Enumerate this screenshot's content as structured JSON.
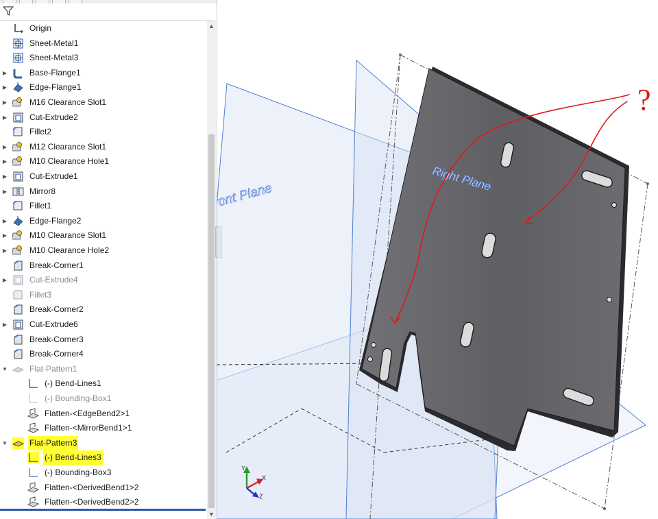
{
  "tree": {
    "items": [
      {
        "label": "Origin",
        "icon": "origin-icon",
        "expand": false,
        "indent": 0,
        "state": "normal"
      },
      {
        "label": "Sheet-Metal1",
        "icon": "sheet-metal-icon",
        "expand": false,
        "indent": 0,
        "state": "normal"
      },
      {
        "label": "Sheet-Metal3",
        "icon": "sheet-metal-icon",
        "expand": false,
        "indent": 0,
        "state": "normal"
      },
      {
        "label": "Base-Flange1",
        "icon": "base-flange-icon",
        "expand": true,
        "indent": 0,
        "state": "normal"
      },
      {
        "label": "Edge-Flange1",
        "icon": "edge-flange-icon",
        "expand": true,
        "indent": 0,
        "state": "normal"
      },
      {
        "label": "M16 Clearance Slot1",
        "icon": "hole-wizard-icon",
        "expand": true,
        "indent": 0,
        "state": "normal"
      },
      {
        "label": "Cut-Extrude2",
        "icon": "cut-extrude-icon",
        "expand": true,
        "indent": 0,
        "state": "normal"
      },
      {
        "label": "Fillet2",
        "icon": "fillet-icon",
        "expand": false,
        "indent": 0,
        "state": "normal"
      },
      {
        "label": "M12 Clearance Slot1",
        "icon": "hole-wizard-icon",
        "expand": true,
        "indent": 0,
        "state": "normal"
      },
      {
        "label": "M10 Clearance Hole1",
        "icon": "hole-wizard-icon",
        "expand": true,
        "indent": 0,
        "state": "normal"
      },
      {
        "label": "Cut-Extrude1",
        "icon": "cut-extrude-icon",
        "expand": true,
        "indent": 0,
        "state": "normal"
      },
      {
        "label": "Mirror8",
        "icon": "mirror-icon",
        "expand": true,
        "indent": 0,
        "state": "normal"
      },
      {
        "label": "Fillet1",
        "icon": "fillet-icon",
        "expand": false,
        "indent": 0,
        "state": "normal"
      },
      {
        "label": "Edge-Flange2",
        "icon": "edge-flange-icon",
        "expand": true,
        "indent": 0,
        "state": "normal"
      },
      {
        "label": "M10 Clearance Slot1",
        "icon": "hole-wizard-icon",
        "expand": true,
        "indent": 0,
        "state": "normal"
      },
      {
        "label": "M10 Clearance Hole2",
        "icon": "hole-wizard-icon",
        "expand": true,
        "indent": 0,
        "state": "normal"
      },
      {
        "label": "Break-Corner1",
        "icon": "break-corner-icon",
        "expand": false,
        "indent": 0,
        "state": "normal"
      },
      {
        "label": "Cut-Extrude4",
        "icon": "cut-extrude-icon",
        "expand": true,
        "indent": 0,
        "state": "dim"
      },
      {
        "label": "Fillet3",
        "icon": "fillet-icon",
        "expand": false,
        "indent": 0,
        "state": "dim"
      },
      {
        "label": "Break-Corner2",
        "icon": "break-corner-icon",
        "expand": false,
        "indent": 0,
        "state": "normal"
      },
      {
        "label": "Cut-Extrude6",
        "icon": "cut-extrude-icon",
        "expand": true,
        "indent": 0,
        "state": "normal"
      },
      {
        "label": "Break-Corner3",
        "icon": "break-corner-icon",
        "expand": false,
        "indent": 0,
        "state": "normal"
      },
      {
        "label": "Break-Corner4",
        "icon": "break-corner-icon",
        "expand": false,
        "indent": 0,
        "state": "normal"
      },
      {
        "label": "Flat-Pattern1",
        "icon": "flat-pattern-icon",
        "expand": "open",
        "indent": 0,
        "state": "dim"
      },
      {
        "label": "(-) Bend-Lines1",
        "icon": "bend-lines-icon",
        "expand": false,
        "indent": 1,
        "state": "normal"
      },
      {
        "label": "(-) Bounding-Box1",
        "icon": "bounding-box-icon",
        "expand": false,
        "indent": 1,
        "state": "dim"
      },
      {
        "label": "Flatten-<EdgeBend2>1",
        "icon": "flatten-icon",
        "expand": false,
        "indent": 1,
        "state": "normal"
      },
      {
        "label": "Flatten-<MirrorBend1>1",
        "icon": "flatten-icon",
        "expand": false,
        "indent": 1,
        "state": "normal"
      },
      {
        "label": "Flat-Pattern3",
        "icon": "flat-pattern-icon",
        "expand": "open",
        "indent": 0,
        "state": "highlight"
      },
      {
        "label": "(-) Bend-Lines3",
        "icon": "bend-lines-icon",
        "expand": false,
        "indent": 1,
        "state": "highlight"
      },
      {
        "label": "(-) Bounding-Box3",
        "icon": "bounding-box-icon",
        "expand": false,
        "indent": 1,
        "state": "normal"
      },
      {
        "label": "Flatten-<DerivedBend1>2",
        "icon": "flatten-icon",
        "expand": false,
        "indent": 1,
        "state": "normal"
      },
      {
        "label": "Flatten-<DerivedBend2>2",
        "icon": "flatten-icon",
        "expand": false,
        "indent": 1,
        "state": "normal"
      }
    ]
  },
  "viewport": {
    "front_plane_label": "ront Plane",
    "right_plane_label": "Right Plane",
    "annotation": "?",
    "triad_axes": [
      "Y",
      "X",
      "Z"
    ]
  },
  "colors": {
    "highlight": "#ffff33",
    "plane_edge": "#4f7fd3",
    "plane_fill": "#dfe8f6",
    "part": "#6b6b6f",
    "annotation": "#e01a1a"
  }
}
